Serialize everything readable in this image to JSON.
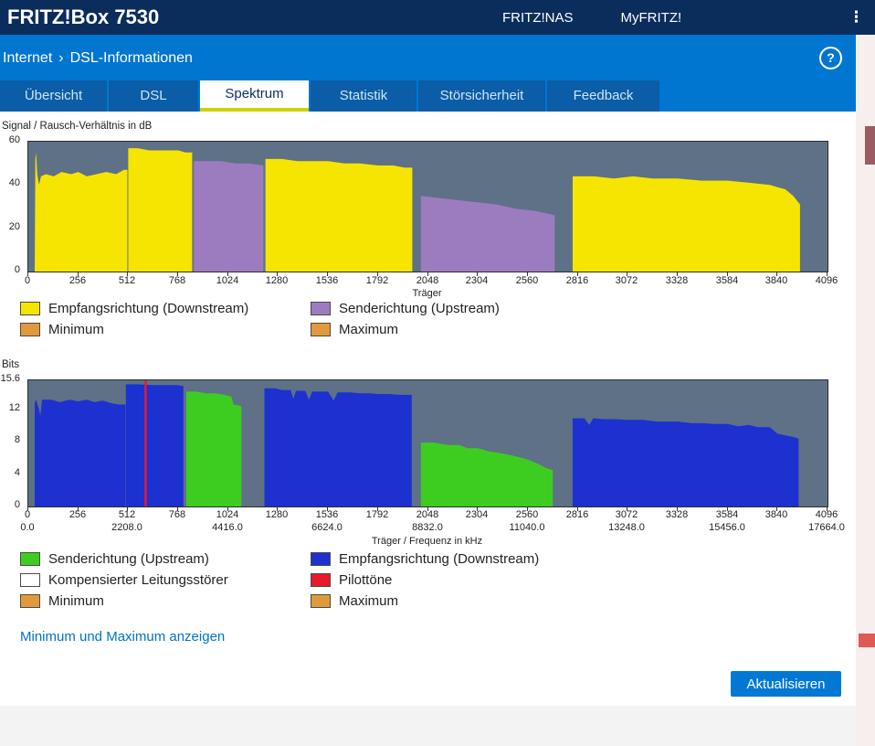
{
  "topbar": {
    "brand": "FRITZ!Box 7530",
    "links": [
      {
        "key": "fritznas",
        "label": "FRITZ!NAS"
      },
      {
        "key": "myfritz",
        "label": "MyFRITZ!"
      }
    ],
    "menu_glyph": "⋮"
  },
  "breadcrumb": {
    "section": "Internet",
    "separator": "›",
    "page": "DSL-Informationen"
  },
  "help_icon_glyph": "?",
  "tabs": [
    {
      "key": "uebersicht",
      "label": "Übersicht",
      "active": false
    },
    {
      "key": "dsl",
      "label": "DSL",
      "active": false
    },
    {
      "key": "spektrum",
      "label": "Spektrum",
      "active": true
    },
    {
      "key": "statistik",
      "label": "Statistik",
      "active": false
    },
    {
      "key": "stoersicherheit",
      "label": "Störsicherheit",
      "active": false
    },
    {
      "key": "feedback",
      "label": "Feedback",
      "active": false
    }
  ],
  "colors": {
    "header_bg": "#0b2d5c",
    "bar_bg": "#0076d1",
    "tab_active_underline": "#ccd400",
    "chart_bg": "#5e7186",
    "downstream_yellow": "#f6e500",
    "upstream_purple": "#9c7cbe",
    "downstream_blue": "#1c31cf",
    "upstream_green": "#3dcd21",
    "pilot_red": "#e8192c",
    "minmax_orange": "#e09a3c",
    "button_bg": "#0078d4",
    "link_color": "#0072c6"
  },
  "chart_data": [
    {
      "type": "area",
      "title": "Signal / Rausch-Verhältnis in dB",
      "xlabel": "Träger",
      "xlim": [
        0,
        4096
      ],
      "ylim": [
        0,
        60
      ],
      "y_ticks": [
        "60",
        "40",
        "20",
        "0"
      ],
      "x_ticks": [
        0,
        256,
        512,
        768,
        1024,
        1280,
        1536,
        1792,
        2048,
        2304,
        2560,
        2816,
        3072,
        3328,
        3584,
        3840,
        4096
      ],
      "plot_bg": "#5e7186",
      "legend_position": "below",
      "grid": false,
      "series": [
        {
          "name": "Empfangsrichtung (Downstream)",
          "color": "#f6e500",
          "segments": [
            [
              [
                33,
                0
              ],
              [
                36,
                52
              ],
              [
                40,
                55
              ],
              [
                46,
                45
              ],
              [
                55,
                40
              ],
              [
                65,
                44
              ],
              [
                90,
                45
              ],
              [
                130,
                44
              ],
              [
                170,
                46
              ],
              [
                220,
                45
              ],
              [
                256,
                46
              ],
              [
                300,
                44
              ],
              [
                350,
                45
              ],
              [
                400,
                46
              ],
              [
                450,
                45
              ],
              [
                490,
                47
              ],
              [
                508,
                47
              ]
            ],
            [
              [
                512,
                57
              ],
              [
                560,
                57
              ],
              [
                620,
                56
              ],
              [
                700,
                56
              ],
              [
                768,
                56
              ],
              [
                805,
                55
              ],
              [
                840,
                55
              ]
            ],
            [
              [
                1215,
                52
              ],
              [
                1300,
                52
              ],
              [
                1380,
                51
              ],
              [
                1460,
                51
              ],
              [
                1536,
                51
              ],
              [
                1620,
                50
              ],
              [
                1700,
                50
              ],
              [
                1792,
                49
              ],
              [
                1870,
                49
              ],
              [
                1930,
                48
              ],
              [
                1968,
                48
              ]
            ],
            [
              [
                2790,
                44
              ],
              [
                2900,
                44
              ],
              [
                3000,
                43
              ],
              [
                3100,
                44
              ],
              [
                3200,
                43
              ],
              [
                3328,
                43
              ],
              [
                3450,
                42
              ],
              [
                3584,
                42
              ],
              [
                3700,
                41
              ],
              [
                3800,
                40
              ],
              [
                3840,
                39
              ],
              [
                3880,
                38
              ],
              [
                3920,
                35
              ],
              [
                3955,
                31
              ]
            ]
          ]
        },
        {
          "name": "Senderichtung (Upstream)",
          "color": "#9c7cbe",
          "segments": [
            [
              [
                848,
                51
              ],
              [
                920,
                51
              ],
              [
                990,
                51
              ],
              [
                1060,
                50
              ],
              [
                1130,
                50
              ],
              [
                1205,
                49
              ]
            ],
            [
              [
                2012,
                35
              ],
              [
                2100,
                34
              ],
              [
                2200,
                33
              ],
              [
                2300,
                32
              ],
              [
                2400,
                31
              ],
              [
                2500,
                29
              ],
              [
                2600,
                28
              ],
              [
                2698,
                26
              ]
            ]
          ]
        }
      ]
    },
    {
      "type": "area",
      "title": "Bits",
      "xlabel": "Träger / Frequenz in kHz",
      "xlim": [
        0,
        4096
      ],
      "ylim": [
        0,
        15.6
      ],
      "y_ticks": [
        "15.6",
        "12",
        "8",
        "4",
        "0"
      ],
      "x_ticks": [
        0,
        256,
        512,
        768,
        1024,
        1280,
        1536,
        1792,
        2048,
        2304,
        2560,
        2816,
        3072,
        3328,
        3584,
        3840,
        4096
      ],
      "x_freq_ticks": [
        {
          "carrier": 0,
          "label": "0.0"
        },
        {
          "carrier": 512,
          "label": "2208.0"
        },
        {
          "carrier": 1024,
          "label": "4416.0"
        },
        {
          "carrier": 1536,
          "label": "6624.0"
        },
        {
          "carrier": 2048,
          "label": "8832.0"
        },
        {
          "carrier": 2560,
          "label": "11040.0"
        },
        {
          "carrier": 3072,
          "label": "13248.0"
        },
        {
          "carrier": 3584,
          "label": "15456.0"
        },
        {
          "carrier": 4096,
          "label": "17664.0"
        }
      ],
      "plot_bg": "#5e7186",
      "legend_position": "below",
      "grid": false,
      "series": [
        {
          "name": "Empfangsrichtung (Downstream)",
          "color": "#1c31cf",
          "segments": [
            [
              [
                33,
                12.8
              ],
              [
                40,
                13.2
              ],
              [
                55,
                12.0
              ],
              [
                62,
                11.2
              ],
              [
                70,
                13.2
              ],
              [
                120,
                13.2
              ],
              [
                160,
                12.9
              ],
              [
                210,
                13.2
              ],
              [
                256,
                13.0
              ],
              [
                300,
                13.2
              ],
              [
                340,
                12.9
              ],
              [
                380,
                13.1
              ],
              [
                420,
                12.8
              ],
              [
                460,
                12.6
              ],
              [
                498,
                12.6
              ]
            ],
            [
              [
                500,
                15.1
              ],
              [
                560,
                15.1
              ],
              [
                640,
                15.0
              ],
              [
                700,
                15.0
              ],
              [
                760,
                15.0
              ],
              [
                795,
                14.9
              ]
            ],
            [
              [
                1210,
                14.6
              ],
              [
                1265,
                14.6
              ],
              [
                1300,
                14.4
              ],
              [
                1345,
                14.4
              ],
              [
                1358,
                13.3
              ],
              [
                1372,
                14.3
              ],
              [
                1420,
                14.3
              ],
              [
                1438,
                13.2
              ],
              [
                1455,
                14.2
              ],
              [
                1500,
                14.2
              ],
              [
                1536,
                14.2
              ],
              [
                1565,
                13.1
              ],
              [
                1585,
                14.1
              ],
              [
                1650,
                14.1
              ],
              [
                1700,
                14.0
              ],
              [
                1750,
                14.0
              ],
              [
                1792,
                13.9
              ],
              [
                1850,
                13.9
              ],
              [
                1900,
                13.8
              ],
              [
                1965,
                13.8
              ]
            ],
            [
              [
                2790,
                10.9
              ],
              [
                2850,
                10.9
              ],
              [
                2875,
                10.1
              ],
              [
                2895,
                10.9
              ],
              [
                2950,
                10.8
              ],
              [
                3010,
                10.8
              ],
              [
                3072,
                10.7
              ],
              [
                3150,
                10.7
              ],
              [
                3220,
                10.5
              ],
              [
                3328,
                10.5
              ],
              [
                3400,
                10.3
              ],
              [
                3460,
                10.3
              ],
              [
                3510,
                10.2
              ],
              [
                3584,
                10.2
              ],
              [
                3640,
                9.9
              ],
              [
                3690,
                10.1
              ],
              [
                3740,
                9.8
              ],
              [
                3800,
                9.8
              ],
              [
                3840,
                9.0
              ],
              [
                3880,
                8.8
              ],
              [
                3920,
                8.6
              ],
              [
                3948,
                8.4
              ]
            ]
          ]
        },
        {
          "name": "Senderichtung (Upstream)",
          "color": "#3dcd21",
          "segments": [
            [
              [
                810,
                14.2
              ],
              [
                860,
                14.2
              ],
              [
                910,
                14.0
              ],
              [
                960,
                14.0
              ],
              [
                1005,
                13.8
              ],
              [
                1040,
                13.6
              ],
              [
                1052,
                12.6
              ],
              [
                1075,
                12.5
              ],
              [
                1092,
                12.4
              ]
            ],
            [
              [
                2012,
                7.9
              ],
              [
                2080,
                7.9
              ],
              [
                2150,
                7.6
              ],
              [
                2210,
                7.6
              ],
              [
                2250,
                7.2
              ],
              [
                2304,
                7.2
              ],
              [
                2360,
                6.8
              ],
              [
                2420,
                6.6
              ],
              [
                2480,
                6.3
              ],
              [
                2530,
                6.0
              ],
              [
                2560,
                5.8
              ],
              [
                2610,
                5.3
              ],
              [
                2650,
                4.8
              ],
              [
                2688,
                4.5
              ]
            ]
          ]
        },
        {
          "name": "Pilottöne",
          "color": "#e8192c",
          "vlines": [
            600
          ]
        }
      ]
    }
  ],
  "legends": {
    "chart1": [
      {
        "label": "Empfangsrichtung (Downstream)",
        "color": "#f6e500"
      },
      {
        "label": "Senderichtung (Upstream)",
        "color": "#9c7cbe"
      },
      {
        "label": "Minimum",
        "color": "#e09a3c"
      },
      {
        "label": "Maximum",
        "color": "#e09a3c"
      }
    ],
    "chart2": [
      {
        "label": "Senderichtung (Upstream)",
        "color": "#3dcd21"
      },
      {
        "label": "Empfangsrichtung (Downstream)",
        "color": "#1c31cf"
      },
      {
        "label": "Kompensierter Leitungsstörer",
        "color": "#ffffff"
      },
      {
        "label": "Pilottöne",
        "color": "#e8192c"
      },
      {
        "label": "Minimum",
        "color": "#e09a3c"
      },
      {
        "label": "Maximum",
        "color": "#e09a3c"
      }
    ]
  },
  "actions": {
    "show_minmax_link": "Minimum und Maximum anzeigen",
    "refresh_button": "Aktualisieren"
  }
}
